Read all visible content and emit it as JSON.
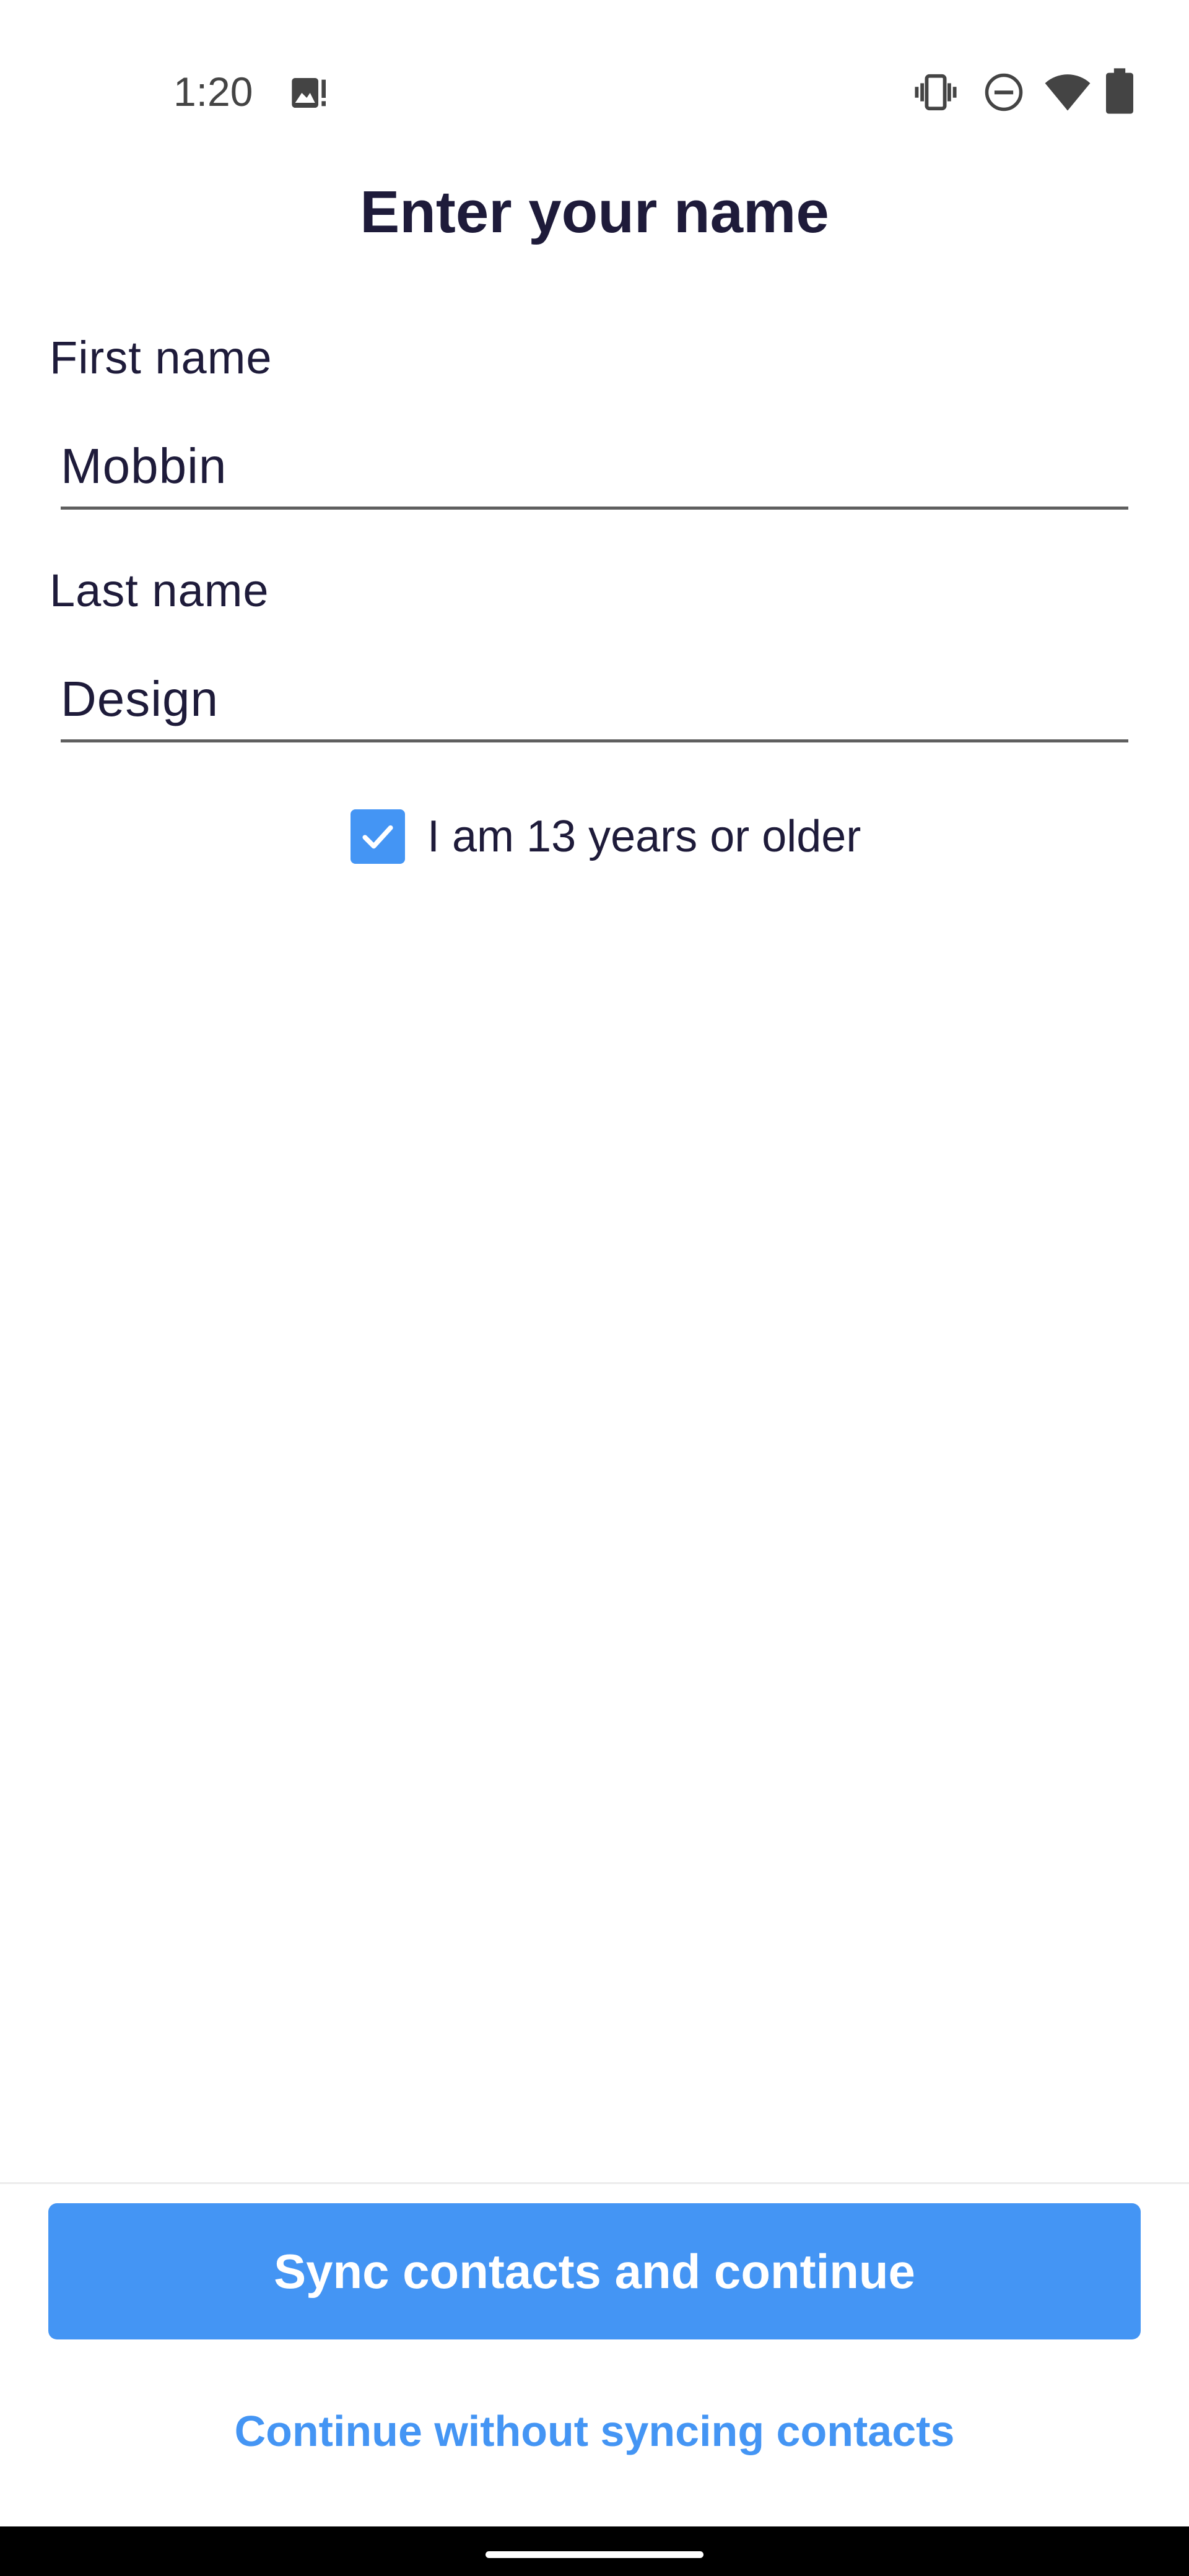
{
  "status_bar": {
    "time": "1:20",
    "icons": [
      "photo-alert-icon",
      "vibrate-icon",
      "do-not-disturb-icon",
      "wifi-icon",
      "battery-icon"
    ]
  },
  "screen": {
    "title": "Enter your name"
  },
  "form": {
    "first_name_label": "First name",
    "first_name_value": "Mobbin",
    "last_name_label": "Last name",
    "last_name_value": "Design",
    "age_checkbox_label": "I am 13 years or older",
    "age_checkbox_checked": true
  },
  "actions": {
    "sync_button_label": "Sync contacts and continue",
    "skip_link_label": "Continue without syncing contacts"
  },
  "colors": {
    "accent": "#4495f4",
    "text_primary": "#1e1b3a",
    "underline": "#5f5f5f"
  }
}
